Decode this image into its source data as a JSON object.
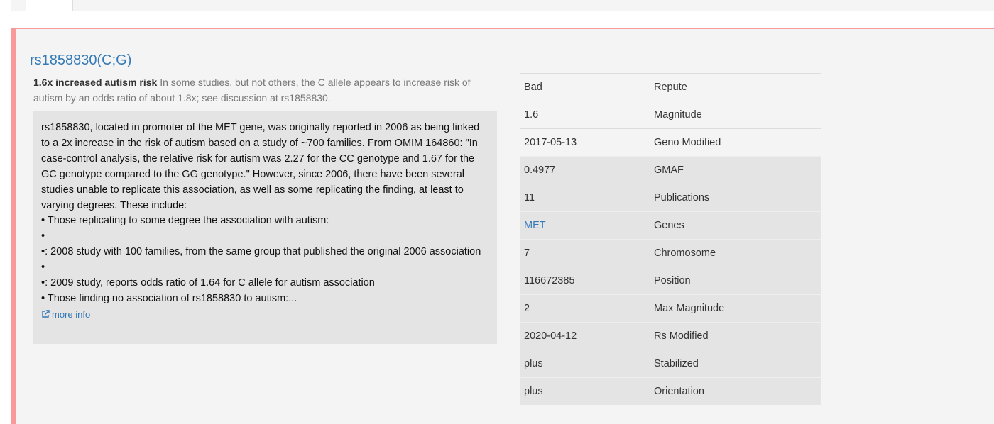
{
  "snp": {
    "title": "rs1858830(C;G)",
    "summary_bold": "1.6x increased autism risk",
    "summary_text": " In some studies, but not others, the C allele appears to increase risk of autism by an odds ratio of about 1.8x; see discussion at rs1858830.",
    "details": [
      "rs1858830, located in promoter of the MET gene, was originally reported in 2006 as being linked to a 2x increase in the risk of autism based on a study of ~700 families. From OMIM 164860: \"In case-control analysis, the relative risk for autism was 2.27 for the CC genotype and 1.67 for the GC genotype compared to the GG genotype.\" However, since 2006, there have been several studies unable to replicate this association, as well as some replicating the finding, at least to varying degrees. These include:",
      "• Those replicating to some degree the association with autism:",
      "•",
      "•: 2008 study with 100 families, from the same group that published the original 2006 association",
      "•",
      "•: 2009 study, reports odds ratio of 1.64 for C allele for autism association",
      "• Those finding no association of rs1858830 to autism:..."
    ],
    "more_info": "more info",
    "more_info_icon": "external-link-icon"
  },
  "facts": [
    {
      "value": "Bad",
      "label": "Repute",
      "shaded": false,
      "link": false
    },
    {
      "value": "1.6",
      "label": "Magnitude",
      "shaded": false,
      "link": false
    },
    {
      "value": "2017-05-13",
      "label": "Geno Modified",
      "shaded": false,
      "link": false
    },
    {
      "value": "0.4977",
      "label": "GMAF",
      "shaded": true,
      "link": false
    },
    {
      "value": "11",
      "label": "Publications",
      "shaded": true,
      "link": false
    },
    {
      "value": "MET",
      "label": "Genes",
      "shaded": true,
      "link": true
    },
    {
      "value": "7",
      "label": "Chromosome",
      "shaded": true,
      "link": false
    },
    {
      "value": "116672385",
      "label": "Position",
      "shaded": true,
      "link": false
    },
    {
      "value": "2",
      "label": "Max Magnitude",
      "shaded": true,
      "link": false
    },
    {
      "value": "2020-04-12",
      "label": "Rs Modified",
      "shaded": true,
      "link": false
    },
    {
      "value": "plus",
      "label": "Stabilized",
      "shaded": true,
      "link": false
    },
    {
      "value": "plus",
      "label": "Orientation",
      "shaded": true,
      "link": false
    }
  ],
  "colors": {
    "accent_border": "#f99a9a",
    "link": "#337ab7",
    "panel": "#e4e4e4"
  }
}
